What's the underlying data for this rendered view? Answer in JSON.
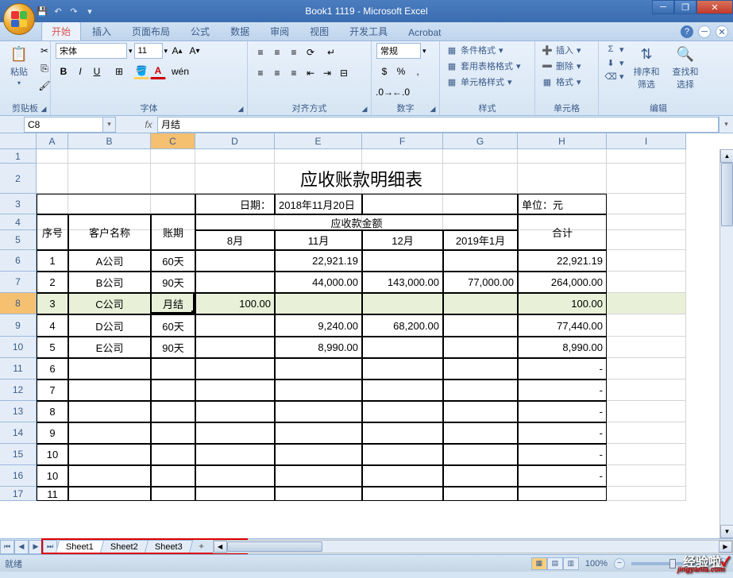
{
  "window": {
    "title": "Book1 1119 - Microsoft Excel"
  },
  "ribbon_tabs": [
    "开始",
    "插入",
    "页面布局",
    "公式",
    "数据",
    "审阅",
    "视图",
    "开发工具",
    "Acrobat"
  ],
  "active_tab": "开始",
  "ribbon": {
    "clipboard": {
      "label": "剪贴板",
      "paste": "粘贴"
    },
    "font": {
      "label": "字体",
      "name": "宋体",
      "size": "11"
    },
    "alignment": {
      "label": "对齐方式"
    },
    "number": {
      "label": "数字",
      "format": "常规"
    },
    "styles": {
      "label": "样式",
      "cond_format": "条件格式",
      "table_format": "套用表格格式",
      "cell_styles": "单元格样式"
    },
    "cells": {
      "label": "单元格",
      "insert": "插入",
      "delete": "删除",
      "format": "格式"
    },
    "editing": {
      "label": "编辑",
      "sort_filter": "排序和\n筛选",
      "find_select": "查找和\n选择"
    }
  },
  "name_box": "C8",
  "formula_value": "月结",
  "columns": [
    {
      "l": "A",
      "w": 40
    },
    {
      "l": "B",
      "w": 104
    },
    {
      "l": "C",
      "w": 56
    },
    {
      "l": "D",
      "w": 100
    },
    {
      "l": "E",
      "w": 110
    },
    {
      "l": "F",
      "w": 102
    },
    {
      "l": "G",
      "w": 94
    },
    {
      "l": "H",
      "w": 112
    },
    {
      "l": "I",
      "w": 100
    }
  ],
  "rows": [
    {
      "n": 1,
      "h": 18
    },
    {
      "n": 2,
      "h": 38
    },
    {
      "n": 3,
      "h": 26
    },
    {
      "n": 4,
      "h": 20
    },
    {
      "n": 5,
      "h": 25
    },
    {
      "n": 6,
      "h": 27
    },
    {
      "n": 7,
      "h": 27
    },
    {
      "n": 8,
      "h": 27
    },
    {
      "n": 9,
      "h": 28
    },
    {
      "n": 10,
      "h": 27
    },
    {
      "n": 11,
      "h": 27
    },
    {
      "n": 12,
      "h": 27
    },
    {
      "n": 13,
      "h": 27
    },
    {
      "n": 14,
      "h": 27
    },
    {
      "n": 15,
      "h": 27
    },
    {
      "n": 16,
      "h": 27
    },
    {
      "n": 17,
      "h": 18
    }
  ],
  "table": {
    "title": "应收账款明细表",
    "date_label": "日期：",
    "date_value": "2018年11月20日",
    "unit_label": "单位：元",
    "h_seq": "序号",
    "h_cust": "客户名称",
    "h_period": "账期",
    "h_recv": "应收款金额",
    "h_total": "合计",
    "months": [
      "8月",
      "11月",
      "12月",
      "2019年1月"
    ],
    "rows": [
      {
        "seq": "1",
        "cust": "A公司",
        "period": "60天",
        "m": [
          "",
          "22,921.19",
          "",
          ""
        ],
        "total": "22,921.19"
      },
      {
        "seq": "2",
        "cust": "B公司",
        "period": "90天",
        "m": [
          "",
          "44,000.00",
          "143,000.00",
          "77,000.00"
        ],
        "total": "264,000.00"
      },
      {
        "seq": "3",
        "cust": "C公司",
        "period": "月结",
        "m": [
          "100.00",
          "",
          "",
          ""
        ],
        "total": "100.00"
      },
      {
        "seq": "4",
        "cust": "D公司",
        "period": "60天",
        "m": [
          "",
          "9,240.00",
          "68,200.00",
          ""
        ],
        "total": "77,440.00"
      },
      {
        "seq": "5",
        "cust": "E公司",
        "period": "90天",
        "m": [
          "",
          "8,990.00",
          "",
          ""
        ],
        "total": "8,990.00"
      },
      {
        "seq": "6",
        "cust": "",
        "period": "",
        "m": [
          "",
          "",
          "",
          ""
        ],
        "total": "-"
      },
      {
        "seq": "7",
        "cust": "",
        "period": "",
        "m": [
          "",
          "",
          "",
          ""
        ],
        "total": "-"
      },
      {
        "seq": "8",
        "cust": "",
        "period": "",
        "m": [
          "",
          "",
          "",
          ""
        ],
        "total": "-"
      },
      {
        "seq": "9",
        "cust": "",
        "period": "",
        "m": [
          "",
          "",
          "",
          ""
        ],
        "total": "-"
      },
      {
        "seq": "10",
        "cust": "",
        "period": "",
        "m": [
          "",
          "",
          "",
          ""
        ],
        "total": "-"
      },
      {
        "seq": "10",
        "cust": "",
        "period": "",
        "m": [
          "",
          "",
          "",
          ""
        ],
        "total": "-"
      },
      {
        "seq": "11",
        "cust": "",
        "period": "",
        "m": [
          "",
          "",
          "",
          ""
        ],
        "total": ""
      }
    ]
  },
  "sheets": [
    "Sheet1",
    "Sheet2",
    "Sheet3"
  ],
  "active_sheet": "Sheet1",
  "status": {
    "ready": "就绪",
    "zoom": "100%"
  },
  "watermark": {
    "text": "经验啦",
    "check": "✓",
    "sub": "jingyanla.com"
  }
}
